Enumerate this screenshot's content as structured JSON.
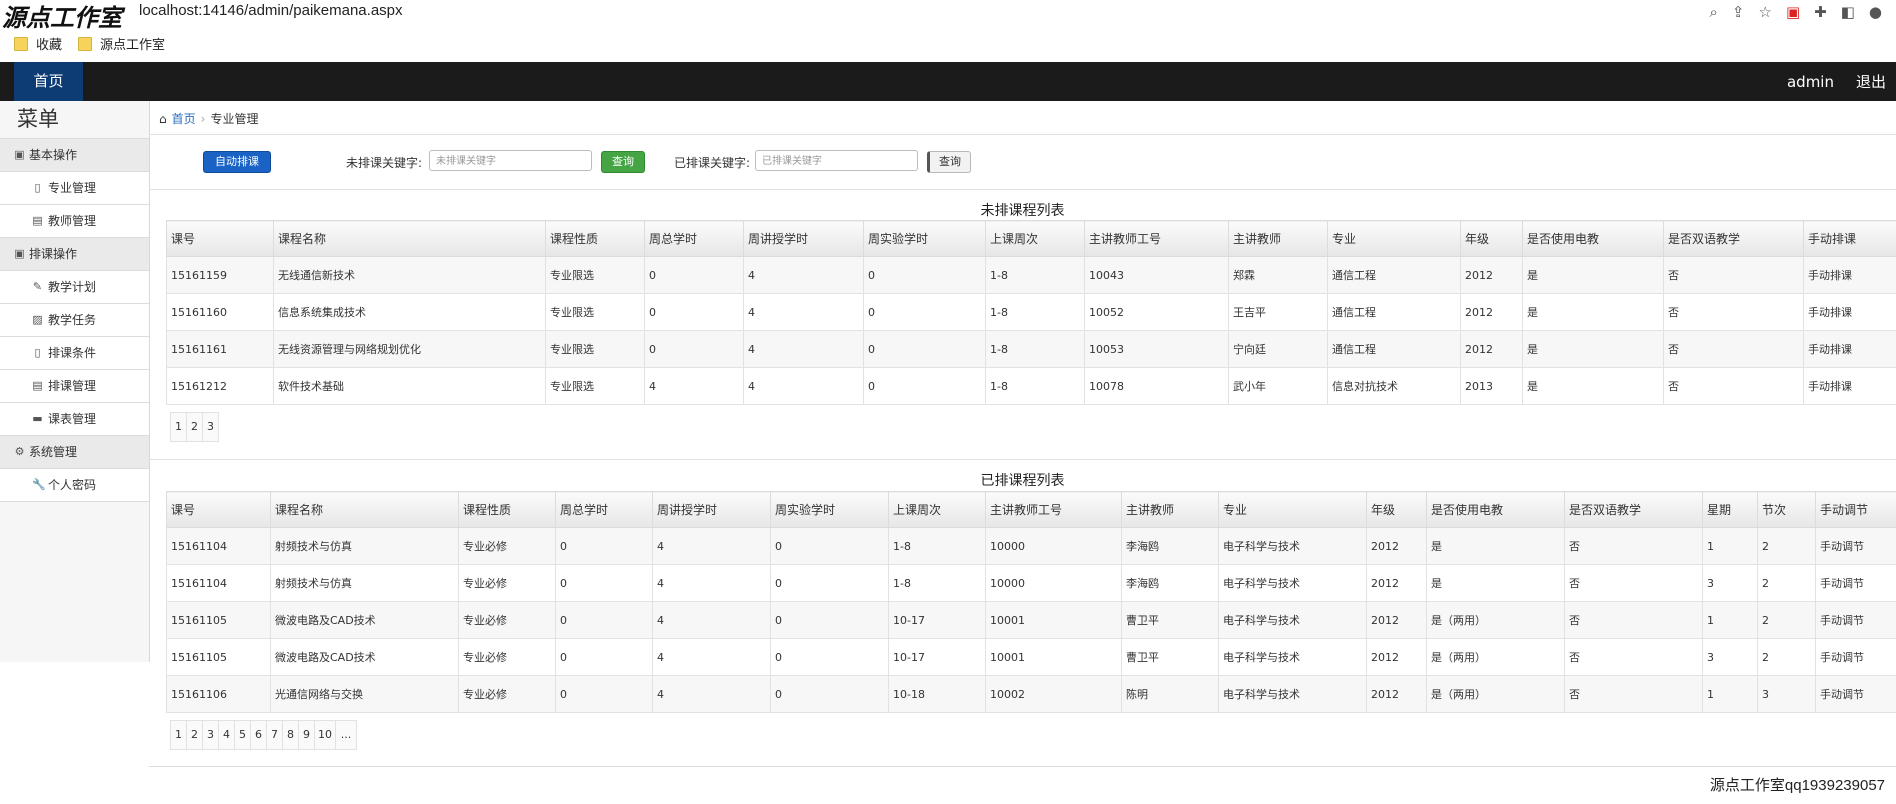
{
  "browser": {
    "logo_text": "源点工作室",
    "url": "localhost:14146/admin/paikemana.aspx",
    "bookmarks": [
      {
        "label": "收藏"
      },
      {
        "label": "源点工作室"
      }
    ]
  },
  "topnav": {
    "home_label": "首页",
    "user": "admin",
    "logout": "退出"
  },
  "sidebar": {
    "title": "菜单",
    "rows": [
      {
        "type": "group",
        "icon": "▣",
        "label": "基本操作"
      },
      {
        "type": "item",
        "icon": "▯",
        "label": "专业管理"
      },
      {
        "type": "item",
        "icon": "▤",
        "label": "教师管理"
      },
      {
        "type": "group",
        "icon": "▣",
        "label": "排课操作"
      },
      {
        "type": "item",
        "icon": "✎",
        "label": "教学计划"
      },
      {
        "type": "item",
        "icon": "▨",
        "label": "教学任务"
      },
      {
        "type": "item",
        "icon": "▯",
        "label": "排课条件"
      },
      {
        "type": "item",
        "icon": "▤",
        "label": "排课管理"
      },
      {
        "type": "item",
        "icon": "▬",
        "label": "课表管理"
      },
      {
        "type": "group",
        "icon": "⚙",
        "label": "系统管理"
      },
      {
        "type": "item",
        "icon": "🔧",
        "label": "个人密码"
      }
    ]
  },
  "breadcrumb": {
    "home": "首页",
    "current": "专业管理"
  },
  "toolbar": {
    "auto_button": "自动排课",
    "unarranged_label": "未排课关键字:",
    "unarranged_placeholder": "未排课关键字",
    "query_button": "查询",
    "arranged_label": "已排课关键字:",
    "arranged_placeholder": "已排课关键字",
    "query_button2": "查询"
  },
  "unarranged": {
    "title": "未排课程列表",
    "columns": [
      "课号",
      "课程名称",
      "课程性质",
      "周总学时",
      "周讲授学时",
      "周实验学时",
      "上课周次",
      "主讲教师工号",
      "主讲教师",
      "专业",
      "年级",
      "是否使用电教",
      "是否双语教学",
      "手动排课"
    ],
    "rows": [
      [
        "15161159",
        "无线通信新技术",
        "专业限选",
        "0",
        "4",
        "0",
        "1-8",
        "10043",
        "郑霖",
        "通信工程",
        "2012",
        "是",
        "否",
        "手动排课"
      ],
      [
        "15161160",
        "信息系统集成技术",
        "专业限选",
        "0",
        "4",
        "0",
        "1-8",
        "10052",
        "王吉平",
        "通信工程",
        "2012",
        "是",
        "否",
        "手动排课"
      ],
      [
        "15161161",
        "无线资源管理与网络规划优化",
        "专业限选",
        "0",
        "4",
        "0",
        "1-8",
        "10053",
        "宁向廷",
        "通信工程",
        "2012",
        "是",
        "否",
        "手动排课"
      ],
      [
        "15161212",
        "软件技术基础",
        "专业限选",
        "4",
        "4",
        "0",
        "1-8",
        "10078",
        "武小年",
        "信息对抗技术",
        "2013",
        "是",
        "否",
        "手动排课"
      ]
    ],
    "pages": [
      "1",
      "2",
      "3"
    ]
  },
  "arranged": {
    "title": "已排课程列表",
    "columns": [
      "课号",
      "课程名称",
      "课程性质",
      "周总学时",
      "周讲授学时",
      "周实验学时",
      "上课周次",
      "主讲教师工号",
      "主讲教师",
      "专业",
      "年级",
      "是否使用电教",
      "是否双语教学",
      "星期",
      "节次",
      "手动调节"
    ],
    "rows": [
      [
        "15161104",
        "射频技术与仿真",
        "专业必修",
        "0",
        "4",
        "0",
        "1-8",
        "10000",
        "李海鸥",
        "电子科学与技术",
        "2012",
        "是",
        "否",
        "1",
        "2",
        "手动调节"
      ],
      [
        "15161104",
        "射频技术与仿真",
        "专业必修",
        "0",
        "4",
        "0",
        "1-8",
        "10000",
        "李海鸥",
        "电子科学与技术",
        "2012",
        "是",
        "否",
        "3",
        "2",
        "手动调节"
      ],
      [
        "15161105",
        "微波电路及CAD技术",
        "专业必修",
        "0",
        "4",
        "0",
        "10-17",
        "10001",
        "曹卫平",
        "电子科学与技术",
        "2012",
        "是（两用）",
        "否",
        "1",
        "2",
        "手动调节"
      ],
      [
        "15161105",
        "微波电路及CAD技术",
        "专业必修",
        "0",
        "4",
        "0",
        "10-17",
        "10001",
        "曹卫平",
        "电子科学与技术",
        "2012",
        "是（两用）",
        "否",
        "3",
        "2",
        "手动调节"
      ],
      [
        "15161106",
        "光通信网络与交换",
        "专业必修",
        "0",
        "4",
        "0",
        "10-18",
        "10002",
        "陈明",
        "电子科学与技术",
        "2012",
        "是（两用）",
        "否",
        "1",
        "3",
        "手动调节"
      ]
    ],
    "pages": [
      "1",
      "2",
      "3",
      "4",
      "5",
      "6",
      "7",
      "8",
      "9",
      "10",
      "..."
    ]
  },
  "footer": "源点工作室qq1939239057"
}
